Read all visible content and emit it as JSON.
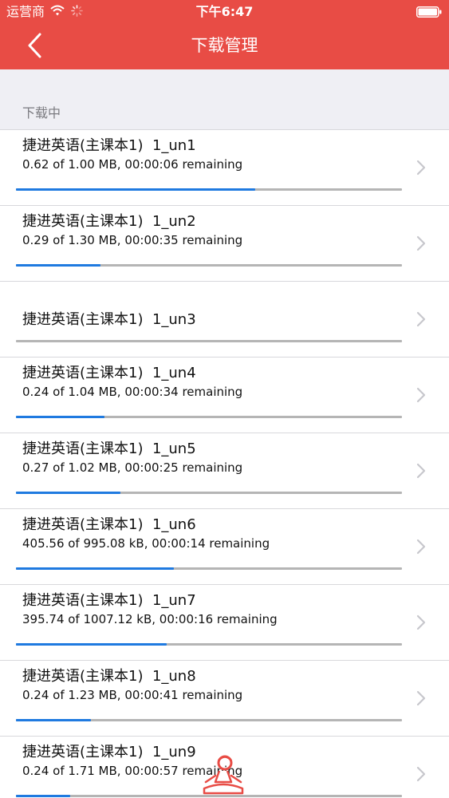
{
  "status_bar": {
    "carrier": "运营商",
    "time": "下午6:47",
    "wifi_icon": "wifi-icon",
    "activity_icon": "loading-spinner-icon",
    "battery_icon": "battery-icon"
  },
  "nav": {
    "title": "下载管理",
    "back_icon": "chevron-left-icon"
  },
  "section": {
    "label": "下载中"
  },
  "colors": {
    "header": "#e84c45",
    "progress_fill": "#1f7ae0",
    "progress_track": "#b5b5b5",
    "section_background": "#efeff4"
  },
  "downloads": [
    {
      "title": "捷进英语(主课本1)  1_un1",
      "status": "0.62 of 1.00 MB, 00:00:06 remaining",
      "progress": 0.62
    },
    {
      "title": "捷进英语(主课本1)  1_un2",
      "status": "0.29 of 1.30 MB, 00:00:35 remaining",
      "progress": 0.22
    },
    {
      "title": "捷进英语(主课本1)  1_un3",
      "status": "",
      "progress": 0
    },
    {
      "title": "捷进英语(主课本1)  1_un4",
      "status": "0.24 of 1.04 MB, 00:00:34 remaining",
      "progress": 0.23
    },
    {
      "title": "捷进英语(主课本1)  1_un5",
      "status": "0.27 of 1.02 MB, 00:00:25 remaining",
      "progress": 0.27
    },
    {
      "title": "捷进英语(主课本1)  1_un6",
      "status": "405.56 of 995.08 kB, 00:00:14 remaining",
      "progress": 0.41
    },
    {
      "title": "捷进英语(主课本1)  1_un7",
      "status": "395.74 of 1007.12 kB, 00:00:16 remaining",
      "progress": 0.39
    },
    {
      "title": "捷进英语(主课本1)  1_un8",
      "status": "0.24 of 1.23 MB, 00:00:41 remaining",
      "progress": 0.195
    },
    {
      "title": "捷进英语(主课本1)  1_un9",
      "status": "0.24 of 1.71 MB, 00:00:57 remaining",
      "progress": 0.14
    }
  ],
  "floating": {
    "mascot_icon": "meditating-figure-icon"
  }
}
